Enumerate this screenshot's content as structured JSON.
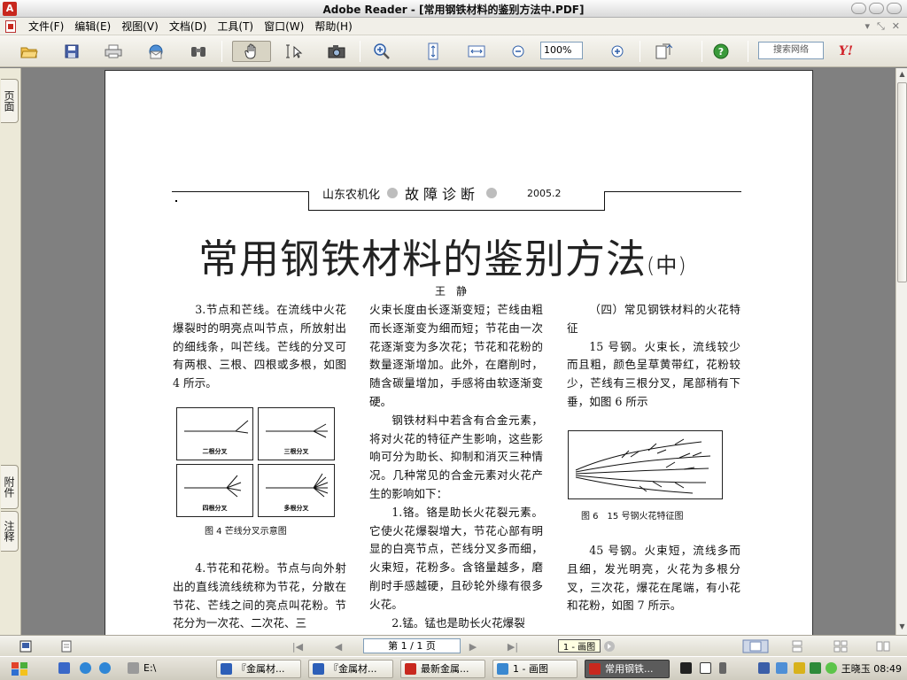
{
  "window": {
    "title": "Adobe Reader - [常用钢铁材料的鉴别方法中.PDF]",
    "app_icon": "adobe-reader-icon"
  },
  "menu": [
    "文件(F)",
    "编辑(E)",
    "视图(V)",
    "文档(D)",
    "工具(T)",
    "窗口(W)",
    "帮助(H)"
  ],
  "toolbar": {
    "zoom": "100%",
    "search_placeholder": "搜索网络",
    "yahoo": "Y!"
  },
  "navrail": {
    "pages_tab": "页面",
    "attachments_tab": "附件",
    "comments_tab": "注释"
  },
  "page": {
    "header": {
      "publication": "山东农机化",
      "section": "故障诊断",
      "year": "2005.2"
    },
    "title": "常用钢铁材料的鉴别方法",
    "title_part": "(中)",
    "author": "王静",
    "col1_p1": "3.节点和芒线。在流线中火花爆裂时的明亮点叫节点，所放射出的细线条，叫芒线。芒线的分叉可有两根、三根、四根或多根，如图 4 所示。",
    "fig4_labels": [
      "二根分叉",
      "三根分叉",
      "四根分叉",
      "多根分叉"
    ],
    "fig4_caption": "图 4 芒线分叉示意图",
    "col1_p2": "4.节花和花粉。节点与向外射出的直线流线统称为节花，分散在节花、芒线之间的亮点叫花粉。节花分为一次花、二次花、三",
    "col2_p1": "火束长度由长逐渐变短；芒线由粗而长逐渐变为细而短；节花由一次花逐渐变为多次花；节花和花粉的数量逐渐增加。此外，在磨削时，随含碳量增加，手感将由软逐渐变硬。",
    "col2_p2": "钢铁材料中若含有合金元素，将对火花的特征产生影响，这些影响可分为助长、抑制和消灭三种情况。几种常见的合金元素对火花产生的影响如下：",
    "col2_p3": "1.铬。铬是助长火花裂元素。它使火花爆裂增大，节花心部有明显的白亮节点，芒线分叉多而细，火束短，花粉多。含铬量越多，磨削时手感越硬，且砂轮外缘有很多火花。",
    "col2_p4": "2.锰。锰也是助长火花爆裂",
    "col3_heading": "（四）常见钢铁材料的火花特征",
    "col3_p1": "15 号钢。火束长，流线较少而且粗，颜色呈草黄带红，花粉较少，芒线有三根分叉，尾部稍有下垂，如图 6 所示",
    "fig6_caption": "图 6　15 号钢火花特征图",
    "col3_p2": "45 号钢。火束短，流线多而且细，发光明亮，火花为多根分叉，三次花，爆花在尾端，有小花和花粉，如图 7 所示。"
  },
  "statusbar": {
    "page_indicator": "第 1 / 1 页",
    "tooltip": "1 - 画图"
  },
  "taskbar": {
    "items": [
      "E:\\",
      "『金属材...",
      "『金属材...",
      "最新金属...",
      "1 - 画图",
      "常用钢铁..."
    ],
    "user": "王晓玉",
    "clock": "08:49"
  },
  "colors": {
    "adobe_red": "#c8281e",
    "page_bg": "#ffffff",
    "workspace_bg": "#808080"
  }
}
